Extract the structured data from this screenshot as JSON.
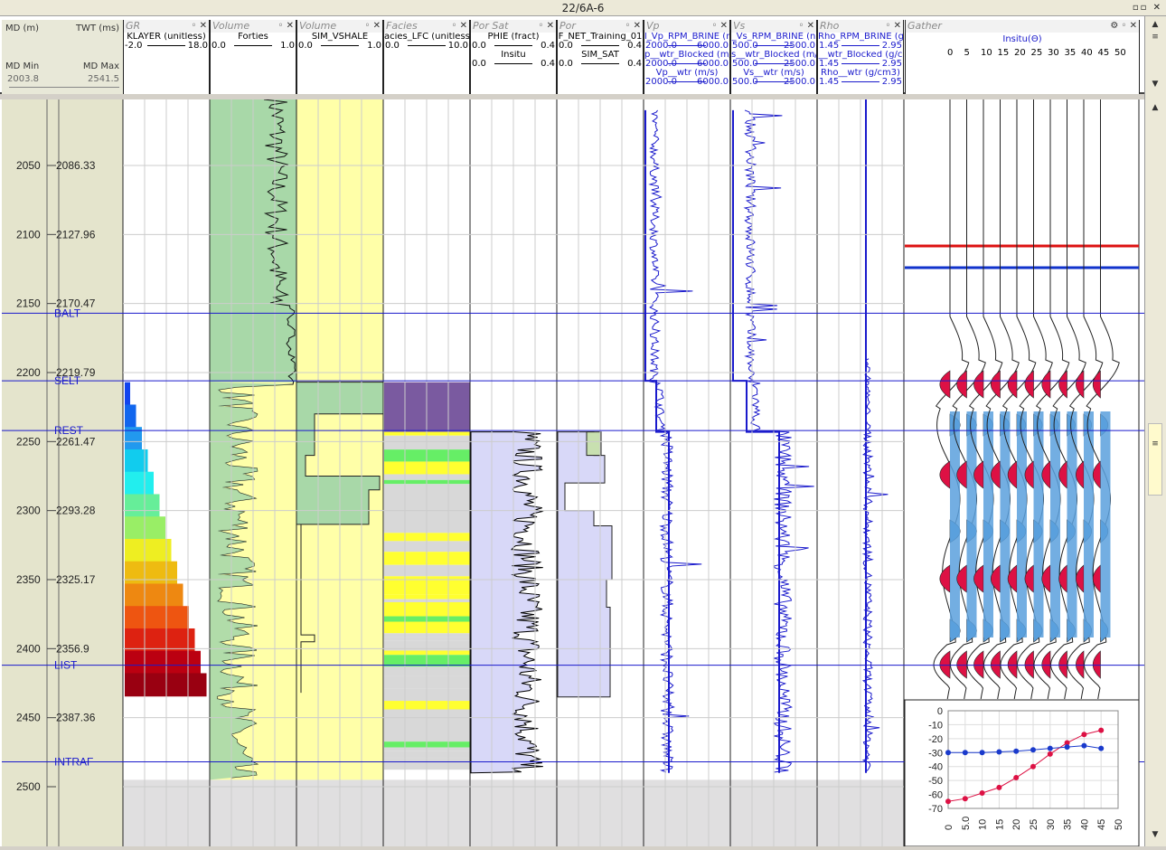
{
  "window": {
    "title": "22/6A-6",
    "controls": "▫▫ ✕"
  },
  "depth_header": {
    "md_label": "MD (m)",
    "twt_label": "TWT (ms)",
    "md_min_label": "MD Min",
    "md_max_label": "MD Max",
    "md_min": "2003.8",
    "md_max": "2541.5"
  },
  "tracks": [
    {
      "id": "gr",
      "name": "GR",
      "curves": [
        {
          "name": "KLAYER (unitless)",
          "lo": "-2.0",
          "hi": "18.0"
        }
      ]
    },
    {
      "id": "vol1",
      "name": "Volume",
      "curves": [
        {
          "name": "Forties",
          "lo": "0.0",
          "hi": "1.0"
        }
      ]
    },
    {
      "id": "vol2",
      "name": "Volume",
      "curves": [
        {
          "name": "SIM_VSHALE",
          "lo": "0.0",
          "hi": "1.0"
        }
      ]
    },
    {
      "id": "facies",
      "name": "Facies",
      "curves": [
        {
          "name": "acies_LFC (unitless",
          "lo": "0.0",
          "hi": "10.0"
        }
      ]
    },
    {
      "id": "porsat",
      "name": "Por Sat",
      "curves": [
        {
          "name": "PHIE (fract)",
          "lo": "0.0",
          "hi": "0.4"
        },
        {
          "name": "Insitu",
          "lo": "0.0",
          "hi": "0.4"
        }
      ]
    },
    {
      "id": "por",
      "name": "Por",
      "curves": [
        {
          "name": "F_NET_Training_01",
          "lo": "0.0",
          "hi": "0.4"
        },
        {
          "name": "SIM_SAT",
          "lo": "0.0",
          "hi": "0.4"
        }
      ]
    },
    {
      "id": "vp",
      "name": "Vp",
      "curves": [
        {
          "name": "l_Vp_RPM_BRINE (n",
          "lo": "2000.0",
          "hi": "6000.0"
        },
        {
          "name": "p__wtr_Blocked (m/s",
          "lo": "2000.0",
          "hi": "6000.0"
        },
        {
          "name": "Vp__wtr (m/s)",
          "lo": "2000.0",
          "hi": "6000.0"
        }
      ]
    },
    {
      "id": "vs",
      "name": "Vs",
      "curves": [
        {
          "name": "_Vs_RPM_BRINE (n",
          "lo": "500.0",
          "hi": "2500.0"
        },
        {
          "name": "s__wtr_Blocked (m/s",
          "lo": "500.0",
          "hi": "2500.0"
        },
        {
          "name": "Vs__wtr (m/s)",
          "lo": "500.0",
          "hi": "2500.0"
        }
      ]
    },
    {
      "id": "rho",
      "name": "Rho",
      "curves": [
        {
          "name": "Rho_RPM_BRINE (g",
          "lo": "1.45",
          "hi": "2.95"
        },
        {
          "name": "__wtr_Blocked (g/c",
          "lo": "1.45",
          "hi": "2.95"
        },
        {
          "name": "Rho__wtr (g/cm3)",
          "lo": "1.45",
          "hi": "2.95"
        }
      ]
    }
  ],
  "gather": {
    "name": "Gather",
    "subtitle": "Insitu(Θ)",
    "angles": [
      "0",
      "5",
      "10",
      "15",
      "20",
      "25",
      "30",
      "35",
      "40",
      "45",
      "50"
    ]
  },
  "depth_axis": {
    "md_ticks": [
      "2050",
      "2100",
      "2150",
      "2200",
      "2250",
      "2300",
      "2350",
      "2400",
      "2450",
      "2500"
    ],
    "twt_ticks": [
      "2086.33",
      "2127.96",
      "2170.47",
      "2219.79",
      "2261.47",
      "2293.28",
      "2325.17",
      "2356.9",
      "2387.36"
    ]
  },
  "horizons": [
    {
      "name": "BALT",
      "md": 2157
    },
    {
      "name": "SELT",
      "md": 2206
    },
    {
      "name": "REST",
      "md": 2242
    },
    {
      "name": "LIST",
      "md": 2412
    },
    {
      "name": "INTRAF",
      "md": 2482
    }
  ],
  "colors": {
    "horizon": "#1a1acc",
    "volume_green": "#a8d8a8",
    "volume_yellow": "#ffffa8",
    "facies_purple": "#7a5aa0",
    "facies_yellow": "#ffff30",
    "facies_grey": "#d8d8d8",
    "porsat_fill": "#d8d8f8",
    "curve_blue": "#1a1acc",
    "gather_red": "#dd1144",
    "gather_blue": "#5aa0dd"
  },
  "chart_data": {
    "type": "scatter",
    "x": [
      0,
      5,
      10,
      15,
      20,
      25,
      30,
      35,
      40,
      45
    ],
    "series": [
      {
        "values": [
          -65,
          -63,
          -59,
          -55,
          -48,
          -40,
          -31,
          -23,
          -17,
          -14
        ],
        "color": "#dd1144"
      },
      {
        "values": [
          -30,
          -30,
          -30,
          -29.5,
          -29,
          -28,
          -27,
          -26,
          -25,
          -27
        ],
        "color": "#1a3acc"
      }
    ],
    "xlim": [
      0,
      50
    ],
    "ylim": [
      -70,
      0
    ],
    "xticks": [
      "0",
      "5.0",
      "10",
      "15",
      "20",
      "25",
      "30",
      "35",
      "40",
      "45",
      "50"
    ],
    "yticks": [
      "0",
      "-10",
      "-20",
      "-30",
      "-40",
      "-50",
      "-60",
      "-70"
    ],
    "grid": true
  }
}
